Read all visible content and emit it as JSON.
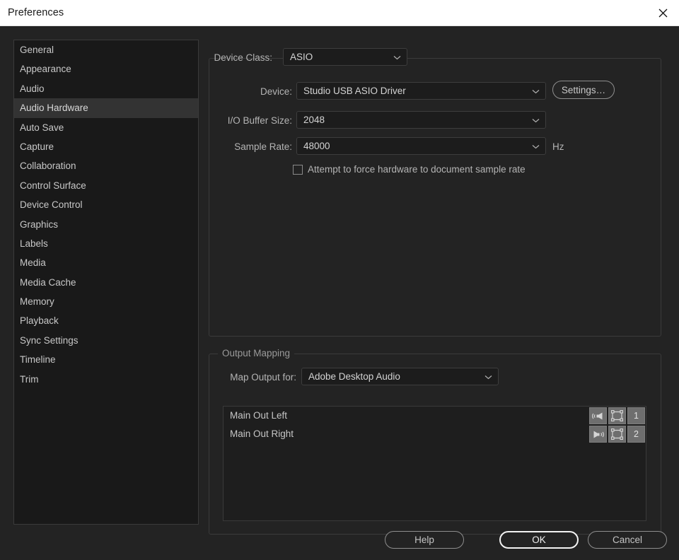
{
  "window": {
    "title": "Preferences",
    "close_icon": "close-icon"
  },
  "sidebar": {
    "items": [
      {
        "label": "General",
        "selected": false
      },
      {
        "label": "Appearance",
        "selected": false
      },
      {
        "label": "Audio",
        "selected": false
      },
      {
        "label": "Audio Hardware",
        "selected": true
      },
      {
        "label": "Auto Save",
        "selected": false
      },
      {
        "label": "Capture",
        "selected": false
      },
      {
        "label": "Collaboration",
        "selected": false
      },
      {
        "label": "Control Surface",
        "selected": false
      },
      {
        "label": "Device Control",
        "selected": false
      },
      {
        "label": "Graphics",
        "selected": false
      },
      {
        "label": "Labels",
        "selected": false
      },
      {
        "label": "Media",
        "selected": false
      },
      {
        "label": "Media Cache",
        "selected": false
      },
      {
        "label": "Memory",
        "selected": false
      },
      {
        "label": "Playback",
        "selected": false
      },
      {
        "label": "Sync Settings",
        "selected": false
      },
      {
        "label": "Timeline",
        "selected": false
      },
      {
        "label": "Trim",
        "selected": false
      }
    ]
  },
  "device_group": {
    "device_class_label": "Device Class:",
    "device_class_value": "ASIO",
    "device_label": "Device:",
    "device_value": "Studio USB ASIO Driver",
    "settings_button": "Settings…",
    "buffer_label": "I/O Buffer Size:",
    "buffer_value": "2048",
    "sample_rate_label": "Sample Rate:",
    "sample_rate_value": "48000",
    "sample_rate_unit": "Hz",
    "force_checkbox_label": "Attempt to force hardware to document sample rate",
    "force_checkbox_checked": false
  },
  "output_group": {
    "legend": "Output Mapping",
    "map_output_label": "Map Output for:",
    "map_output_value": "Adobe Desktop Audio",
    "rows": [
      {
        "name": "Main Out Left",
        "speaker_icon": "speaker-left-icon",
        "clip_icon": "clip-icon",
        "channel": "1"
      },
      {
        "name": "Main Out Right",
        "speaker_icon": "speaker-right-icon",
        "clip_icon": "clip-icon",
        "channel": "2"
      }
    ]
  },
  "footer": {
    "help": "Help",
    "ok": "OK",
    "cancel": "Cancel"
  },
  "colors": {
    "dialog_bg": "#232323",
    "sidebar_bg": "#191919",
    "selected_row": "#333333",
    "accent_border": "#f2f2f2"
  }
}
